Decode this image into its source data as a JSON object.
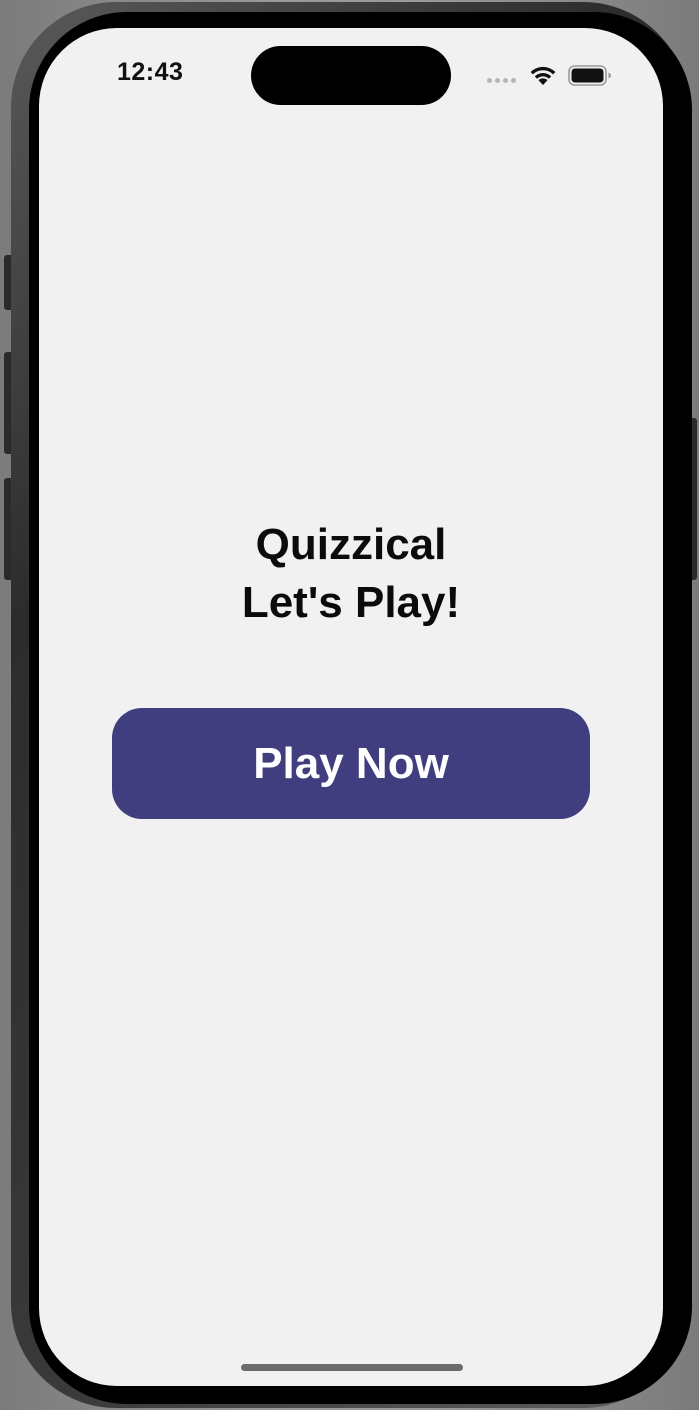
{
  "status_bar": {
    "time": "12:43",
    "wifi_icon": "wifi-icon",
    "battery_icon": "battery-icon"
  },
  "main": {
    "title": "Quizzical",
    "subtitle": "Let's Play!",
    "play_button_label": "Play Now"
  },
  "colors": {
    "background": "#f1f1f2",
    "button": "#403e7e",
    "button_text": "#ffffff",
    "text": "#0b0b0b"
  }
}
